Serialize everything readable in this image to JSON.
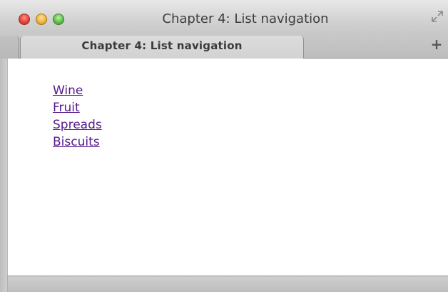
{
  "window": {
    "title": "Chapter 4: List navigation"
  },
  "tabs": [
    {
      "label": "Chapter 4: List navigation",
      "active": true
    }
  ],
  "new_tab_label": "+",
  "nav_links": [
    {
      "label": "Wine"
    },
    {
      "label": "Fruit"
    },
    {
      "label": "Spreads"
    },
    {
      "label": "Biscuits"
    }
  ],
  "colors": {
    "link_visited": "#551a8b",
    "close": "#e2463b",
    "minimize": "#f0b53a",
    "zoom": "#5fc04a"
  },
  "icons": {
    "fullscreen": "fullscreen-icon",
    "new_tab": "plus-icon"
  }
}
